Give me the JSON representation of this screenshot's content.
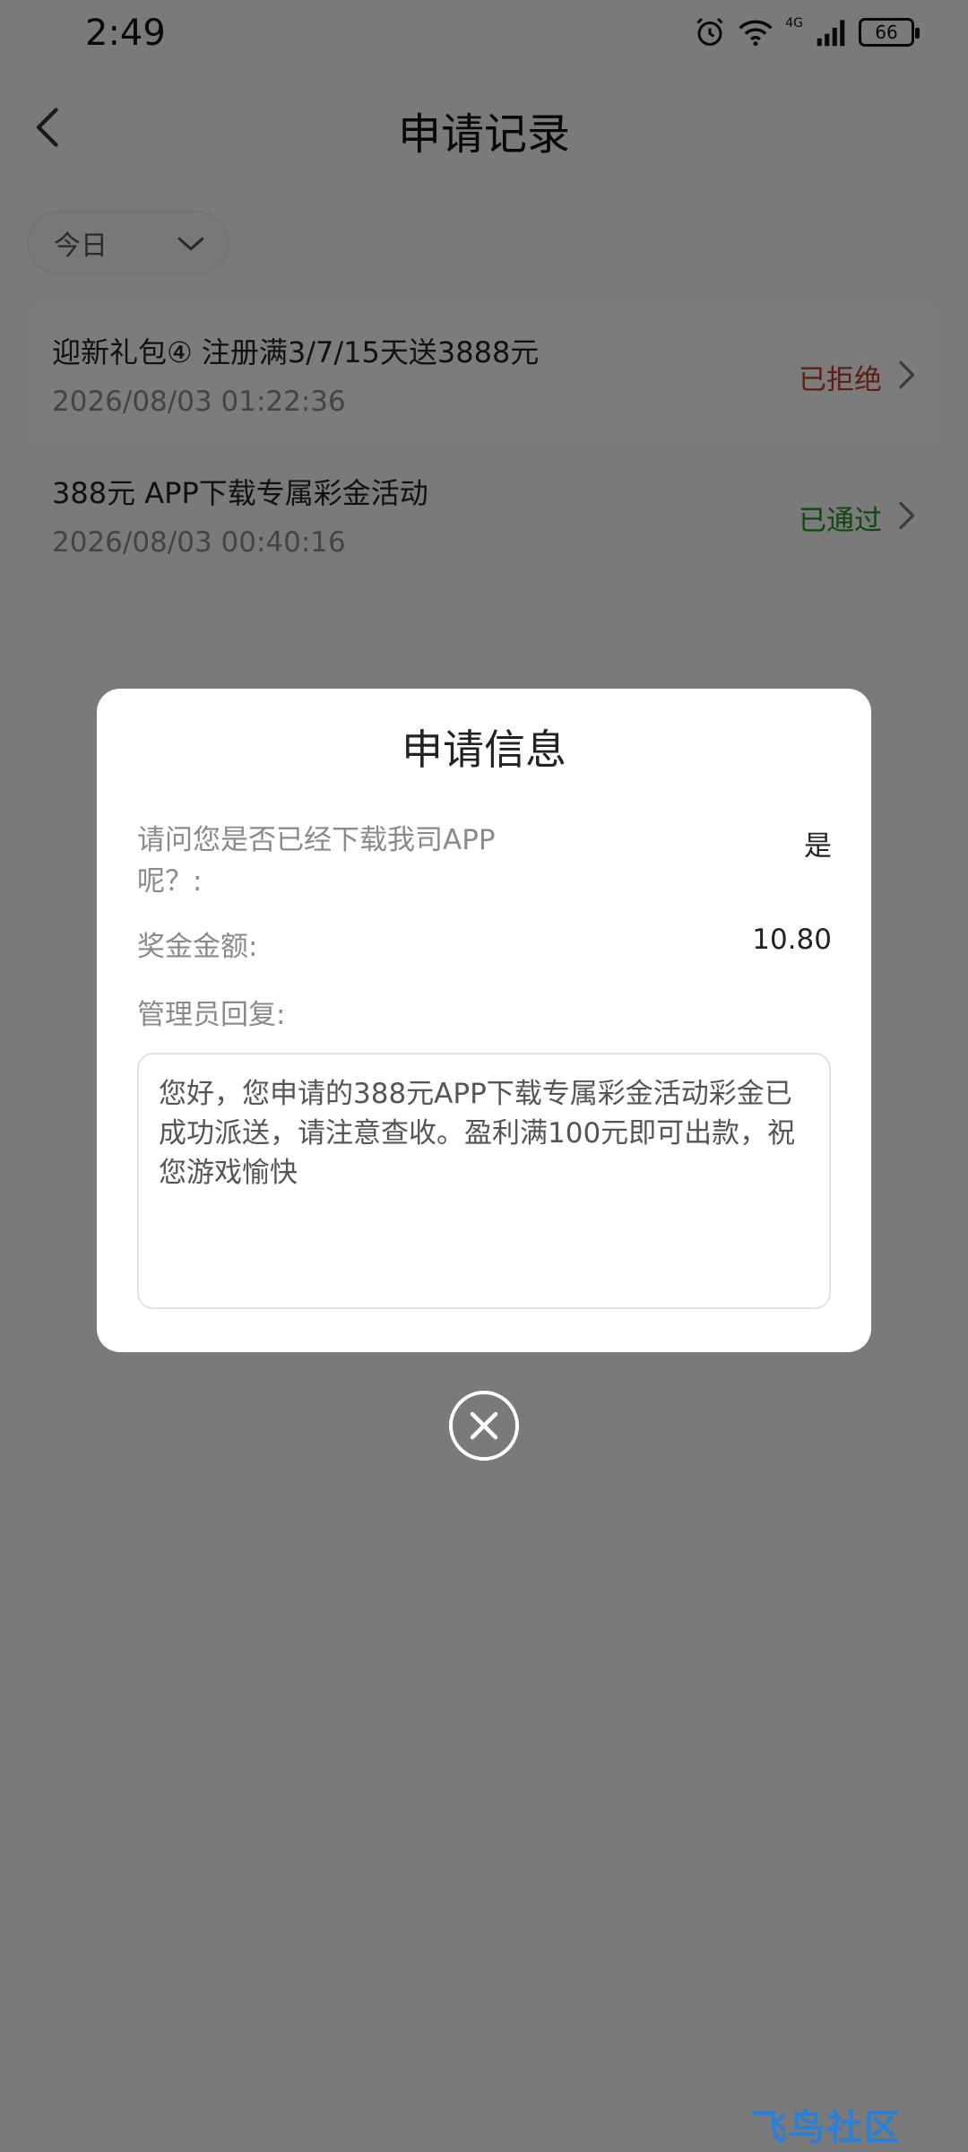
{
  "status_bar": {
    "time": "2:49",
    "network": "4G",
    "battery": "66"
  },
  "header": {
    "title": "申请记录"
  },
  "filter": {
    "label": "今日"
  },
  "records": [
    {
      "title": "迎新礼包④ 注册满3/7/15天送3888元",
      "time": "2026/08/03 01:22:36",
      "status": "已拒绝",
      "status_color": "#c0392b"
    },
    {
      "title": "388元 APP下载专属彩金活动",
      "time": "2026/08/03 00:40:16",
      "status": "已通过",
      "status_color": "#1e8e1e"
    }
  ],
  "dialog": {
    "title": "申请信息",
    "question_label": "请问您是否已经下载我司APP呢？:",
    "question_value": "是",
    "amount_label": "奖金金额:",
    "amount_value": "10.80",
    "reply_label": "管理员回复:",
    "reply_text": "您好，您申请的388元APP下载专属彩金活动彩金已成功派送，请注意查收。盈利满100元即可出款，祝您游戏愉快"
  },
  "watermark": "飞鸟社区",
  "colors": {
    "overlay": "rgba(0,0,0,0.5)",
    "rejected": "#c0392b",
    "approved": "#1e8e1e"
  }
}
